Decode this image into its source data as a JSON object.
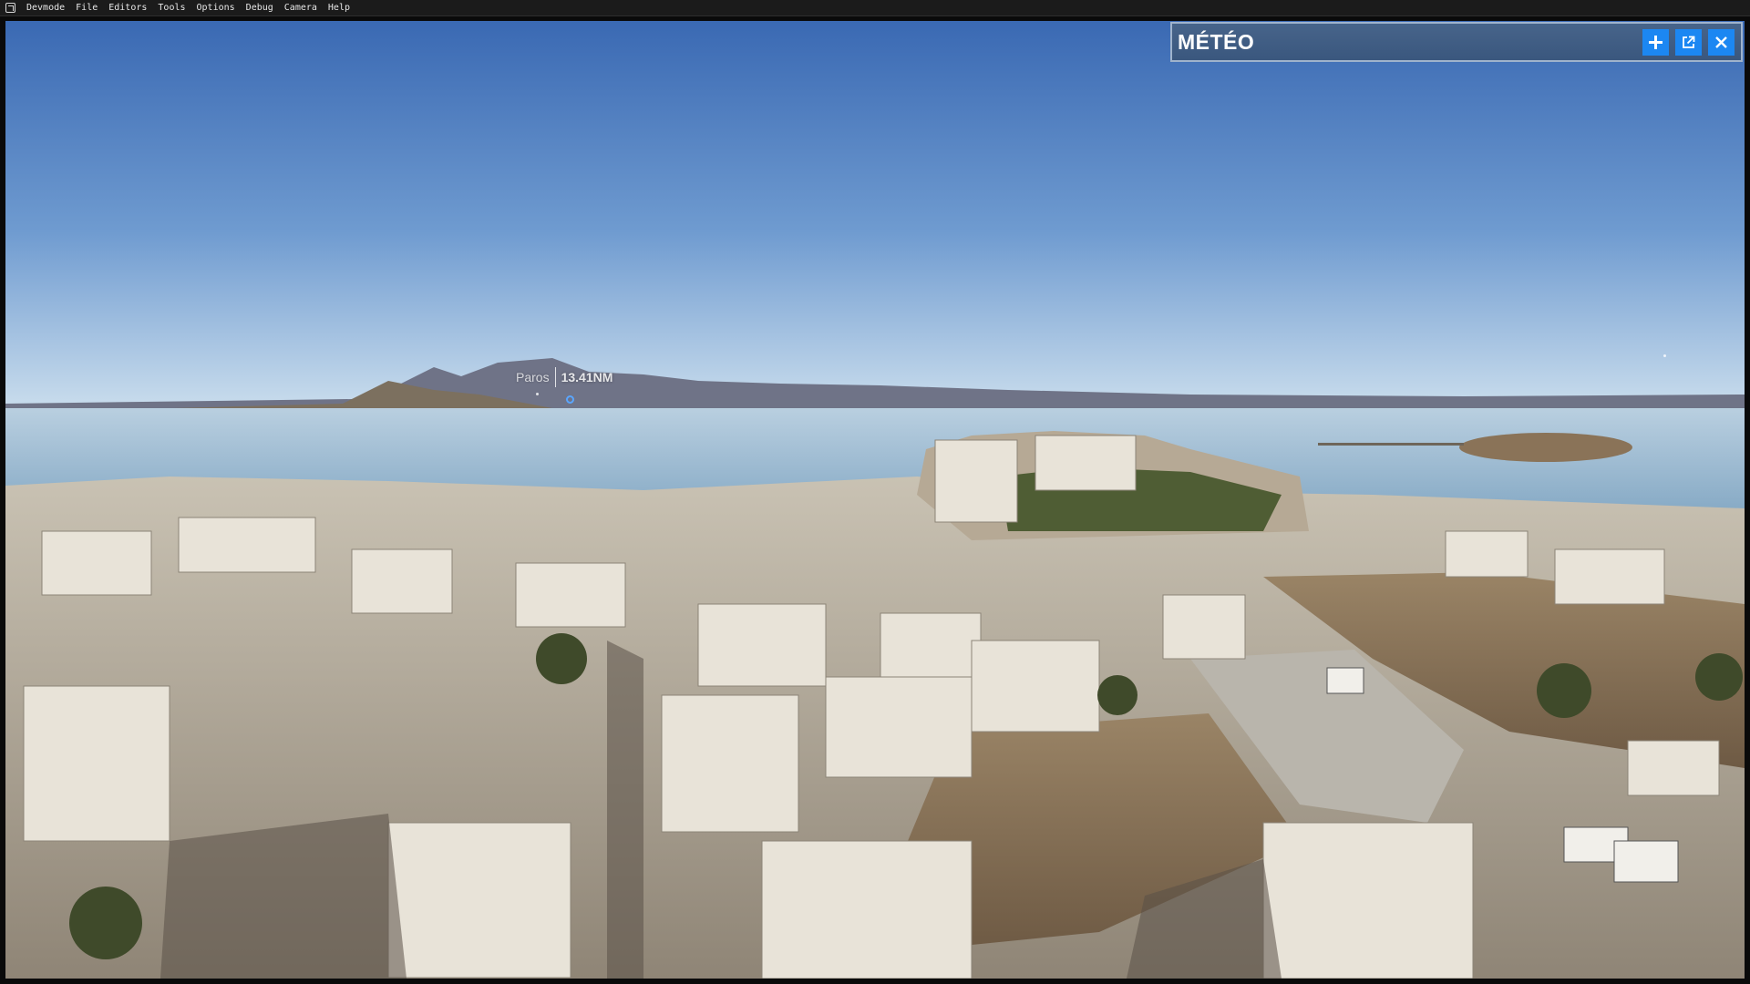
{
  "menubar": {
    "items": [
      "Devmode",
      "File",
      "Editors",
      "Tools",
      "Options",
      "Debug",
      "Camera",
      "Help"
    ]
  },
  "poi": {
    "name": "Paros",
    "distance": "13.41NM"
  },
  "meteo_panel": {
    "title": "MÉTÉO",
    "buttons": [
      "plus-icon",
      "popout-icon",
      "close-icon"
    ],
    "accent_color": "#1c87f2"
  },
  "colors": {
    "sky_top": "#3f6eb8",
    "sky_horizon": "#c4d9ec",
    "sea": "#9dbad0",
    "panel_bg": "#3f5c83"
  }
}
